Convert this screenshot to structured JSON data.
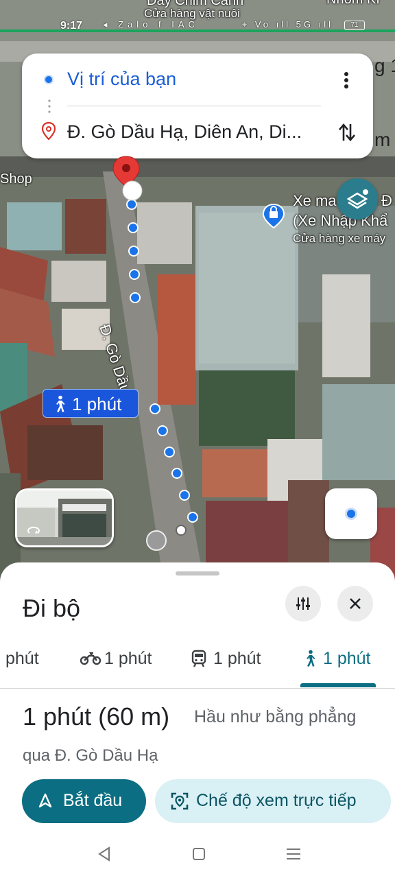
{
  "status_bar": {
    "time": "9:17",
    "left_icons": "◂ Zalo f IAC",
    "right_icons": "⌖ Vo ıll 5G ıll",
    "battery": "71"
  },
  "route_card": {
    "origin": "Vị trí của bạn",
    "destination": "Đ. Gò Dầu Hạ, Diên An, Di..."
  },
  "map": {
    "top_label": "Dây Chim Cảnh",
    "top_sublabel": "Cửa hàng vật nuôi",
    "top_right_label": "Nhom Kí",
    "edge_label_1": "g 1",
    "edge_label_2": "m",
    "shop_label": "Shop",
    "poi_name_1": "Xe ma",
    "poi_name_2": "(Xe Nhập Khẩ",
    "poi_category": "Cửa hàng xe máy",
    "poi_edge": "Đ",
    "street_label": "Đ. Gò Dầu Hạ",
    "walk_chip": "1 phút"
  },
  "sheet": {
    "title": "Đi bộ",
    "tabs": [
      {
        "label": "phút",
        "icon": "car-icon"
      },
      {
        "label": "1 phút",
        "icon": "motorbike-icon"
      },
      {
        "label": "1 phút",
        "icon": "transit-icon"
      },
      {
        "label": "1 phút",
        "icon": "walk-icon",
        "active": true
      }
    ],
    "route_time": "1 phút (60 m)",
    "route_desc": "Hầu như bằng phẳng",
    "route_via": "qua Đ. Gò Dầu Hạ",
    "start_label": "Bắt đầu",
    "live_view_label": "Chế độ xem trực tiếp"
  },
  "colors": {
    "accent": "#0b6e82",
    "route_blue": "#1a73e8",
    "chip_blue": "#1a56db",
    "pin_red": "#e53935"
  }
}
